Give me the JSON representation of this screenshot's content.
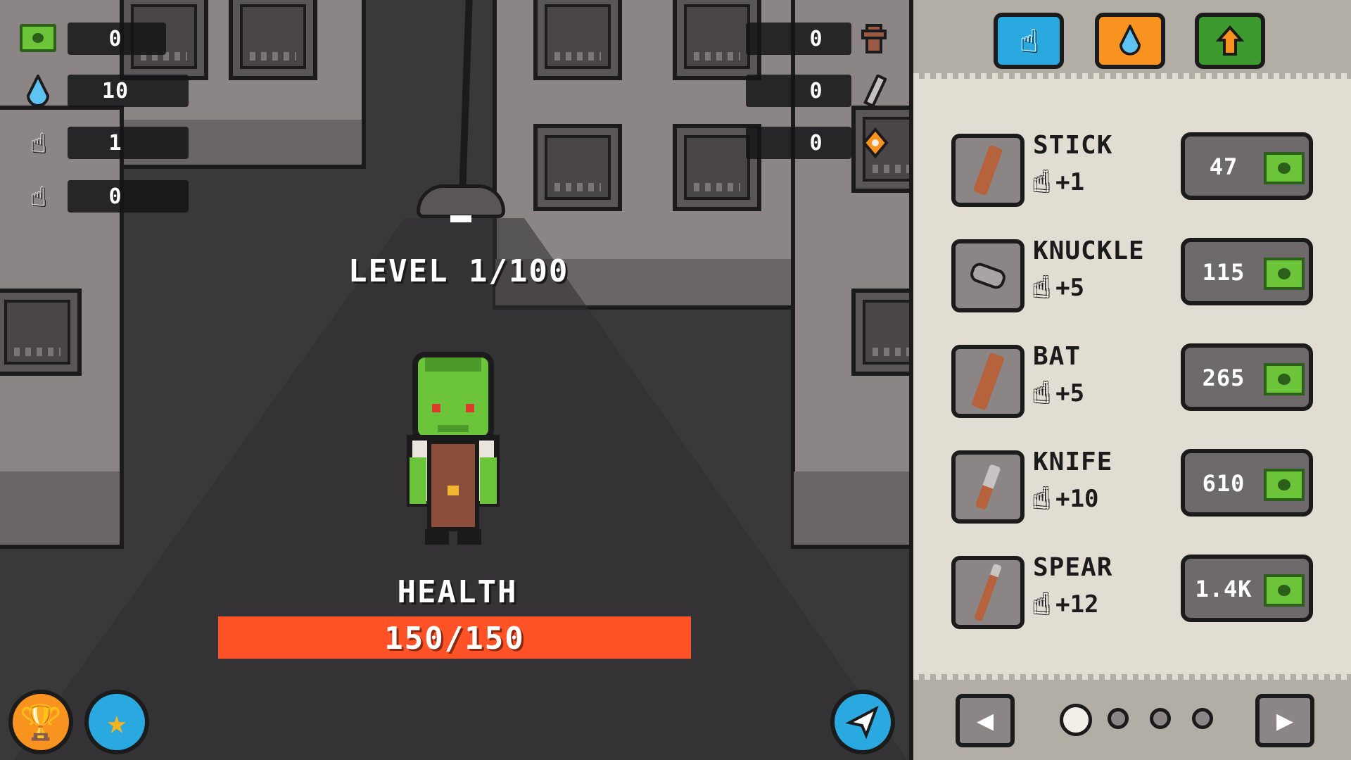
{
  "hud": {
    "left_stats": [
      {
        "icon": "cash-icon",
        "value": "0"
      },
      {
        "icon": "water-drop-icon",
        "value": "10"
      },
      {
        "icon": "hand-icon",
        "value": "1"
      },
      {
        "icon": "auto-hand-icon",
        "value": "0"
      }
    ],
    "right_stats": [
      {
        "icon": "fire-hydrant-icon",
        "value": "0"
      },
      {
        "icon": "pipe-icon",
        "value": "0"
      },
      {
        "icon": "gem-icon",
        "value": "0"
      }
    ]
  },
  "enemy": {
    "level_text": "LEVEL 1/100",
    "health_label": "HEALTH",
    "health_text": "150/150",
    "health_fraction": 1.0
  },
  "shop": {
    "tabs": [
      {
        "icon": "hand-icon",
        "color": "#2aa9e0"
      },
      {
        "icon": "water-drop-icon",
        "color": "#f7931e"
      },
      {
        "icon": "rank-up-icon",
        "color": "#3c9a2e"
      }
    ],
    "items": [
      {
        "name": "STICK",
        "bonus_icon": "hand-icon",
        "bonus": "+1",
        "price": "47",
        "weapon_color": "#b5623d"
      },
      {
        "name": "KNUCKLE",
        "bonus_icon": "auto-hand-icon",
        "bonus": "+5",
        "price": "115",
        "weapon_color": "#a9a4a4"
      },
      {
        "name": "BAT",
        "bonus_icon": "hand-icon",
        "bonus": "+5",
        "price": "265",
        "weapon_color": "#b5623d"
      },
      {
        "name": "KNIFE",
        "bonus_icon": "auto-hand-icon",
        "bonus": "+10",
        "price": "610",
        "weapon_color": "#c9c4c4"
      },
      {
        "name": "SPEAR",
        "bonus_icon": "hand-icon",
        "bonus": "+12",
        "price": "1.4K",
        "weapon_color": "#b5623d"
      }
    ],
    "page": {
      "current": 1,
      "total": 4
    }
  },
  "colors": {
    "health": "#ff5227",
    "cash": "#6bc43a",
    "trophy_button": "#f7931e",
    "star_button": "#2aa9e0",
    "share_button": "#2aa9e0"
  }
}
